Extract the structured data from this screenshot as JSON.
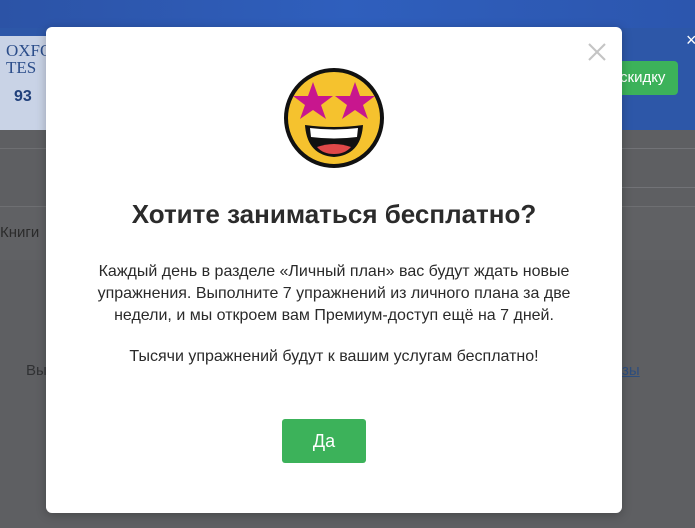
{
  "background": {
    "book": {
      "title": "OXFO\nTES",
      "number": "93"
    },
    "banner_button_label": "скидку",
    "banner_close": "×",
    "nav_books_label": "Книги",
    "content_text_left": "Вы",
    "content_link_right": "зы"
  },
  "modal": {
    "icon": "star-struck-emoji-icon",
    "title": "Хотите заниматься бесплатно?",
    "paragraph1": "Каждый день в разделе «Личный план» вас будут ждать новые упражнения. Выполните 7 упражнений из личного плана за две недели, и мы откроем вам Премиум-доступ ещё на 7 дней.",
    "paragraph2": "Тысячи упражнений будут к вашим услугам бесплатно!",
    "confirm_label": "Да",
    "close_icon": "close-icon"
  },
  "colors": {
    "accent_green": "#3cb25a",
    "banner_blue": "#2d57a8",
    "emoji_yellow": "#f5c22e",
    "star_magenta": "#c8168e"
  }
}
